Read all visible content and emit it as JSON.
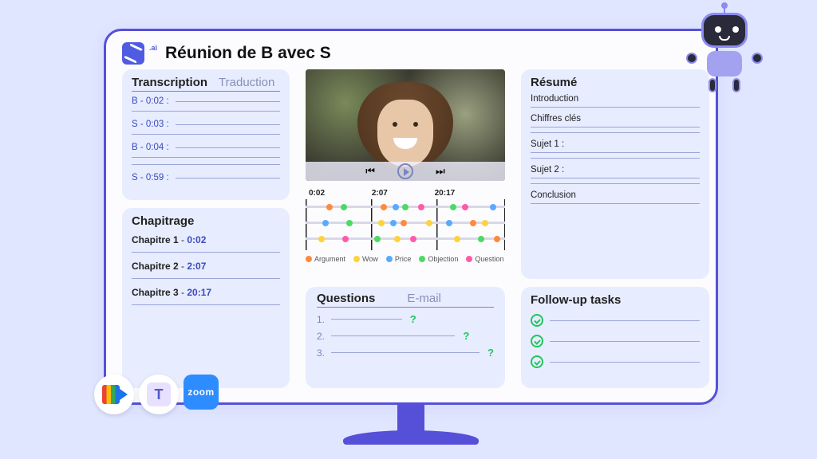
{
  "header": {
    "title": "Réunion de B avec S",
    "logo_suffix": ".ai"
  },
  "transcription": {
    "tabs": {
      "active": "Transcription",
      "inactive": "Traduction"
    },
    "lines": [
      {
        "speaker": "B",
        "time": "0:02"
      },
      {
        "speaker": "S",
        "time": "0:03"
      },
      {
        "speaker": "B",
        "time": "0:04"
      },
      {
        "speaker": "S",
        "time": "0:59"
      }
    ]
  },
  "chapitrage": {
    "title": "Chapitrage",
    "chapters": [
      {
        "label": "Chapitre 1",
        "time": "0:02"
      },
      {
        "label": "Chapitre 2",
        "time": "2:07"
      },
      {
        "label": "Chapitre 3",
        "time": "20:17"
      }
    ]
  },
  "timeline": {
    "labels": [
      "0:02",
      "2:07",
      "20:17"
    ],
    "legend": [
      {
        "name": "Argument",
        "color": "#ff8a3d"
      },
      {
        "name": "Wow",
        "color": "#ffd23d"
      },
      {
        "name": "Price",
        "color": "#5aa9ff"
      },
      {
        "name": "Objection",
        "color": "#4cd964"
      },
      {
        "name": "Question",
        "color": "#ff5aa8"
      }
    ],
    "dots": [
      {
        "track": 1,
        "x": 12,
        "color": "#ff8a3d"
      },
      {
        "track": 1,
        "x": 19,
        "color": "#4cd964"
      },
      {
        "track": 1,
        "x": 39,
        "color": "#ff8a3d"
      },
      {
        "track": 1,
        "x": 45,
        "color": "#5aa9ff"
      },
      {
        "track": 1,
        "x": 50,
        "color": "#4cd964"
      },
      {
        "track": 1,
        "x": 58,
        "color": "#ff5aa8"
      },
      {
        "track": 1,
        "x": 74,
        "color": "#4cd964"
      },
      {
        "track": 1,
        "x": 80,
        "color": "#ff5aa8"
      },
      {
        "track": 1,
        "x": 94,
        "color": "#5aa9ff"
      },
      {
        "track": 2,
        "x": 10,
        "color": "#5aa9ff"
      },
      {
        "track": 2,
        "x": 22,
        "color": "#4cd964"
      },
      {
        "track": 2,
        "x": 38,
        "color": "#ffd23d"
      },
      {
        "track": 2,
        "x": 44,
        "color": "#5aa9ff"
      },
      {
        "track": 2,
        "x": 49,
        "color": "#ff8a3d"
      },
      {
        "track": 2,
        "x": 62,
        "color": "#ffd23d"
      },
      {
        "track": 2,
        "x": 72,
        "color": "#5aa9ff"
      },
      {
        "track": 2,
        "x": 84,
        "color": "#ff8a3d"
      },
      {
        "track": 2,
        "x": 90,
        "color": "#ffd23d"
      },
      {
        "track": 3,
        "x": 8,
        "color": "#ffd23d"
      },
      {
        "track": 3,
        "x": 20,
        "color": "#ff5aa8"
      },
      {
        "track": 3,
        "x": 36,
        "color": "#4cd964"
      },
      {
        "track": 3,
        "x": 46,
        "color": "#ffd23d"
      },
      {
        "track": 3,
        "x": 54,
        "color": "#ff5aa8"
      },
      {
        "track": 3,
        "x": 76,
        "color": "#ffd23d"
      },
      {
        "track": 3,
        "x": 88,
        "color": "#4cd964"
      },
      {
        "track": 3,
        "x": 96,
        "color": "#ff8a3d"
      }
    ]
  },
  "questions": {
    "tabs": {
      "active": "Questions",
      "inactive": "E-mail"
    },
    "items": [
      "1.",
      "2.",
      "3."
    ]
  },
  "resume": {
    "title": "Résumé",
    "sections": [
      "Introduction",
      "Chiffres clés",
      "Sujet 1 :",
      "Sujet 2 :",
      "Conclusion"
    ]
  },
  "tasks": {
    "title": "Follow-up tasks",
    "count": 3
  },
  "integrations": [
    "google-meet",
    "microsoft-teams",
    "zoom"
  ]
}
